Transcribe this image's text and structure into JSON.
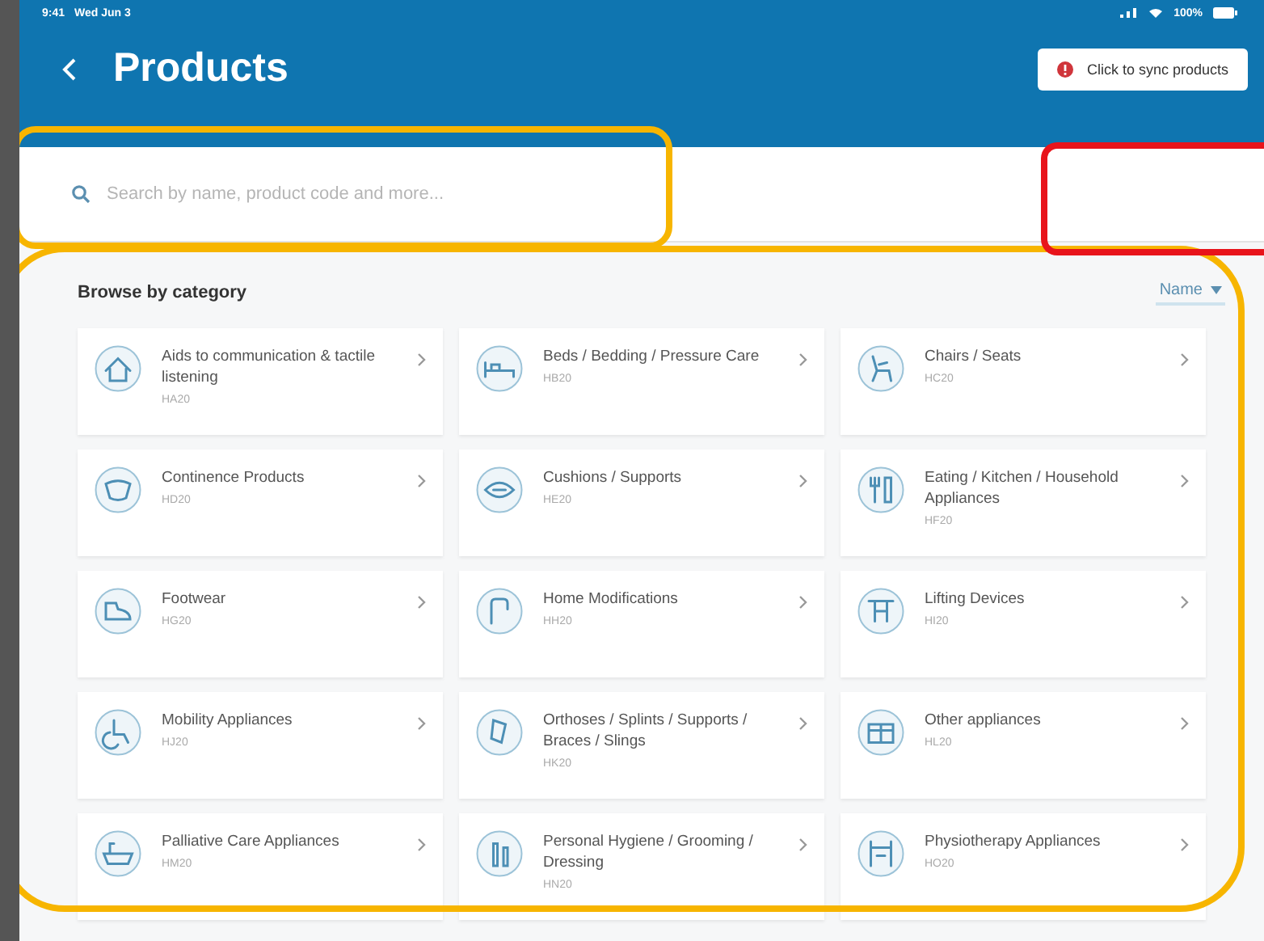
{
  "status_bar": {
    "time": "9:41",
    "date": "Wed Jun 3",
    "battery": "100%"
  },
  "header": {
    "title": "Products",
    "sync_button": "Click to sync products"
  },
  "search": {
    "placeholder": "Search by name, product code and more..."
  },
  "browse": {
    "title": "Browse by category",
    "sort": "Name"
  },
  "categories": [
    {
      "name": "Aids to communication & tactile listening",
      "code": "HA20"
    },
    {
      "name": "Beds / Bedding / Pressure Care",
      "code": "HB20"
    },
    {
      "name": "Chairs / Seats",
      "code": "HC20"
    },
    {
      "name": "Continence Products",
      "code": "HD20"
    },
    {
      "name": "Cushions / Supports",
      "code": "HE20"
    },
    {
      "name": "Eating / Kitchen / Household Appliances",
      "code": "HF20"
    },
    {
      "name": "Footwear",
      "code": "HG20"
    },
    {
      "name": "Home Modifications",
      "code": "HH20"
    },
    {
      "name": "Lifting Devices",
      "code": "HI20"
    },
    {
      "name": "Mobility Appliances",
      "code": "HJ20"
    },
    {
      "name": "Orthoses / Splints / Supports / Braces / Slings",
      "code": "HK20"
    },
    {
      "name": "Other appliances",
      "code": "HL20"
    },
    {
      "name": "Palliative Care Appliances",
      "code": "HM20"
    },
    {
      "name": "Personal Hygiene / Grooming / Dressing",
      "code": "HN20"
    },
    {
      "name": "Physiotherapy Appliances",
      "code": "HO20"
    }
  ]
}
